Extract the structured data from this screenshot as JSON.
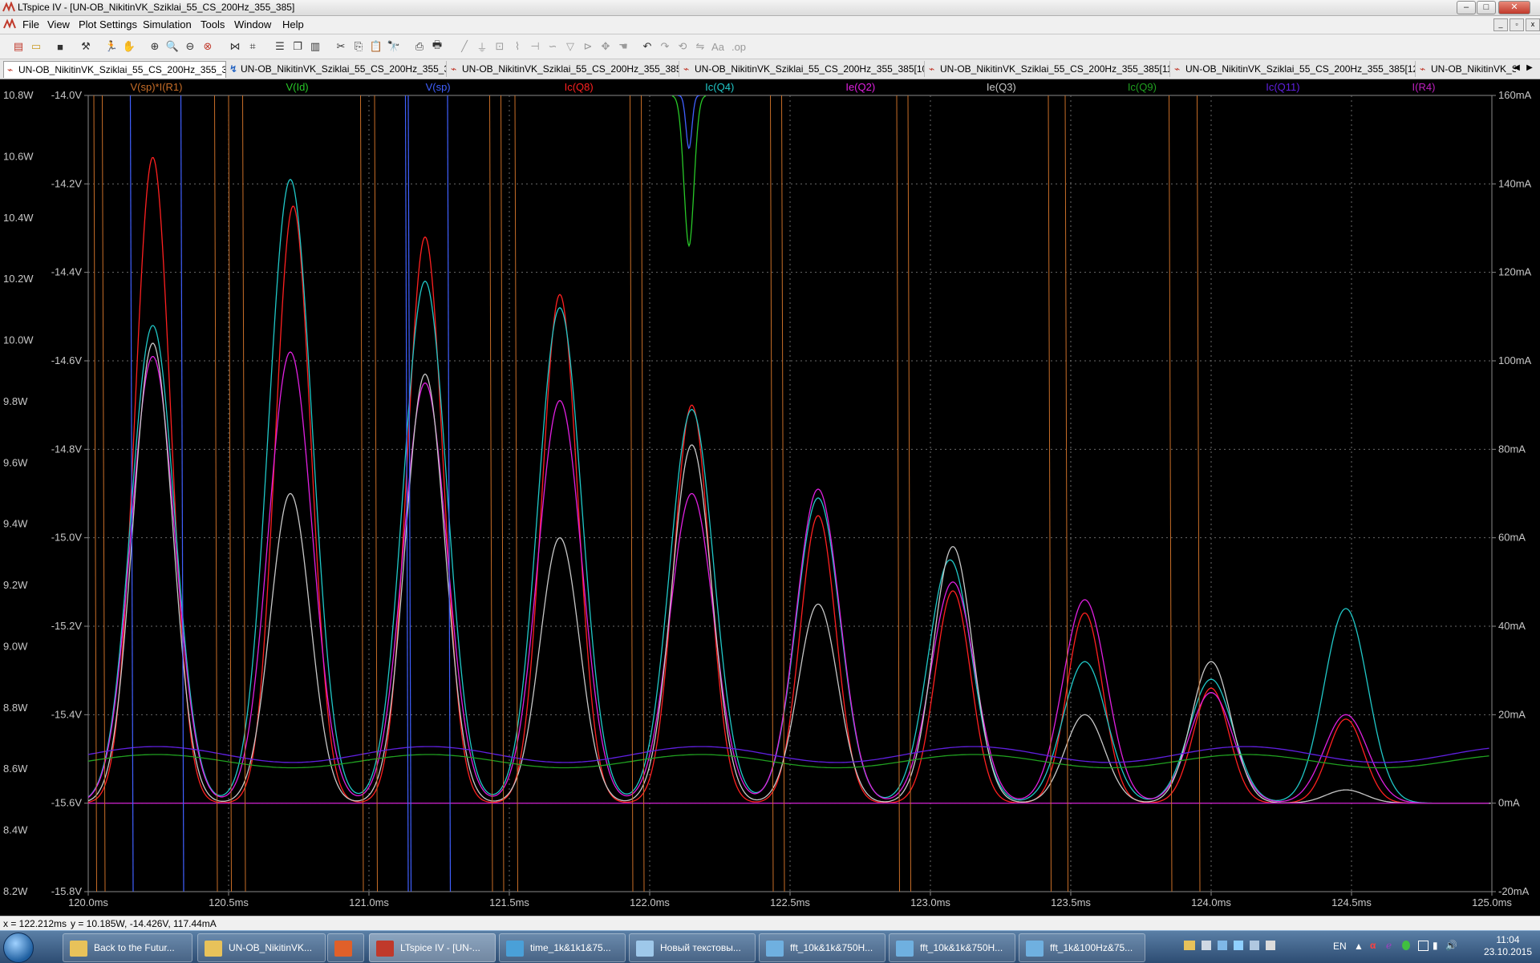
{
  "window": {
    "title": "LTspice IV - [UN-OB_NikitinVK_Sziklai_55_CS_200Hz_355_385]"
  },
  "menu": [
    "File",
    "View",
    "Plot Settings",
    "Simulation",
    "Tools",
    "Window",
    "Help"
  ],
  "tabs": [
    "UN-OB_NikitinVK_Sziklai_55_CS_200Hz_355_385",
    "UN-OB_NikitinVK_Sziklai_55_CS_200Hz_355_385",
    "UN-OB_NikitinVK_Sziklai_55_CS_200Hz_355_385.fft",
    "UN-OB_NikitinVK_Sziklai_55_CS_200Hz_355_385[10].fft",
    "UN-OB_NikitinVK_Sziklai_55_CS_200Hz_355_385[11].fft",
    "UN-OB_NikitinVK_Sziklai_55_CS_200Hz_355_385[12].fft",
    "UN-OB_NikitinVK_S"
  ],
  "status": {
    "cursor_x": "x = 122.212ms",
    "cursor_y": "y = 10.185W, -14.426V, 117.44mA"
  },
  "taskbar": {
    "items": [
      {
        "label": "Back to the Futur...",
        "color": "#e8c25a"
      },
      {
        "label": "UN-OB_NikitinVK...",
        "color": "#e8c25a"
      },
      {
        "label": "",
        "color": "#e0602a"
      },
      {
        "label": "LTspice IV - [UN-...",
        "color": "#c0392b"
      },
      {
        "label": "time_1k&1k1&75...",
        "color": "#4aa0d8"
      },
      {
        "label": "Новый текстовы...",
        "color": "#9ec8ea"
      },
      {
        "label": "fft_10k&1k&750H...",
        "color": "#6fb0e0"
      },
      {
        "label": "fft_10k&1k&750H...",
        "color": "#6fb0e0"
      },
      {
        "label": "fft_1k&100Hz&75...",
        "color": "#6fb0e0"
      }
    ],
    "lang": "EN",
    "time": "11:04",
    "date": "23.10.2015"
  },
  "chart_data": {
    "type": "line",
    "xlabel": "",
    "x_ticks": [
      "120.0ms",
      "120.5ms",
      "121.0ms",
      "121.5ms",
      "122.0ms",
      "122.5ms",
      "123.0ms",
      "123.5ms",
      "124.0ms",
      "124.5ms",
      "125.0ms"
    ],
    "xlim": [
      120.0,
      125.0
    ],
    "grid": true,
    "axes": [
      {
        "name": "power",
        "unit": "W",
        "range": [
          8.2,
          10.8
        ],
        "ticks": [
          "10.8W",
          "10.6W",
          "10.4W",
          "10.2W",
          "10.0W",
          "9.8W",
          "9.6W",
          "9.4W",
          "9.2W",
          "9.0W",
          "8.8W",
          "8.6W",
          "8.4W",
          "8.2W"
        ]
      },
      {
        "name": "voltage",
        "unit": "V",
        "range": [
          -15.8,
          -14.0
        ],
        "ticks": [
          "-14.0V",
          "-14.2V",
          "-14.4V",
          "-14.6V",
          "-14.8V",
          "-15.0V",
          "-15.2V",
          "-15.4V",
          "-15.6V",
          "-15.8V"
        ]
      },
      {
        "name": "current",
        "unit": "mA",
        "range": [
          -20,
          160
        ],
        "ticks": [
          "160mA",
          "140mA",
          "120mA",
          "100mA",
          "80mA",
          "60mA",
          "40mA",
          "20mA",
          "0mA",
          "-20mA"
        ]
      }
    ],
    "series": [
      {
        "name": "V(sp)*I(R1)",
        "color": "#c86e28",
        "axis": "power"
      },
      {
        "name": "V(Id)",
        "color": "#28c828",
        "axis": "voltage"
      },
      {
        "name": "V(sp)",
        "color": "#4060ff",
        "axis": "voltage"
      },
      {
        "name": "Ic(Q8)",
        "color": "#ff2020",
        "axis": "current",
        "peaks": [
          [
            120.23,
            146
          ],
          [
            120.73,
            135
          ],
          [
            121.2,
            128
          ],
          [
            121.68,
            115
          ],
          [
            122.15,
            90
          ],
          [
            122.6,
            65
          ],
          [
            123.08,
            48
          ],
          [
            123.55,
            43
          ],
          [
            124.0,
            26
          ],
          [
            124.48,
            19
          ]
        ]
      },
      {
        "name": "Ic(Q4)",
        "color": "#20c8c8",
        "axis": "current",
        "peaks": [
          [
            120.23,
            108
          ],
          [
            120.72,
            141
          ],
          [
            121.2,
            118
          ],
          [
            121.68,
            112
          ],
          [
            122.15,
            89
          ],
          [
            122.6,
            69
          ],
          [
            123.07,
            55
          ],
          [
            123.55,
            32
          ],
          [
            124.0,
            28
          ],
          [
            124.48,
            44
          ]
        ]
      },
      {
        "name": "Ie(Q2)",
        "color": "#e020e0",
        "axis": "current",
        "peaks": [
          [
            120.23,
            101
          ],
          [
            120.72,
            102
          ],
          [
            121.2,
            95
          ],
          [
            121.68,
            91
          ],
          [
            122.15,
            70
          ],
          [
            122.6,
            71
          ],
          [
            123.08,
            50
          ],
          [
            123.55,
            46
          ],
          [
            124.0,
            25
          ],
          [
            124.48,
            20
          ]
        ]
      },
      {
        "name": "Ie(Q3)",
        "color": "#c8c8c8",
        "axis": "current",
        "peaks": [
          [
            120.23,
            104
          ],
          [
            120.72,
            70
          ],
          [
            121.2,
            97
          ],
          [
            121.68,
            60
          ],
          [
            122.15,
            81
          ],
          [
            122.6,
            45
          ],
          [
            123.08,
            58
          ],
          [
            123.55,
            20
          ],
          [
            124.0,
            32
          ],
          [
            124.48,
            3
          ]
        ]
      },
      {
        "name": "Ic(Q9)",
        "color": "#20a020",
        "axis": "current"
      },
      {
        "name": "Ic(Q11)",
        "color": "#6020e0",
        "axis": "current"
      },
      {
        "name": "I(R4)",
        "color": "#c020c0",
        "axis": "current"
      }
    ]
  }
}
